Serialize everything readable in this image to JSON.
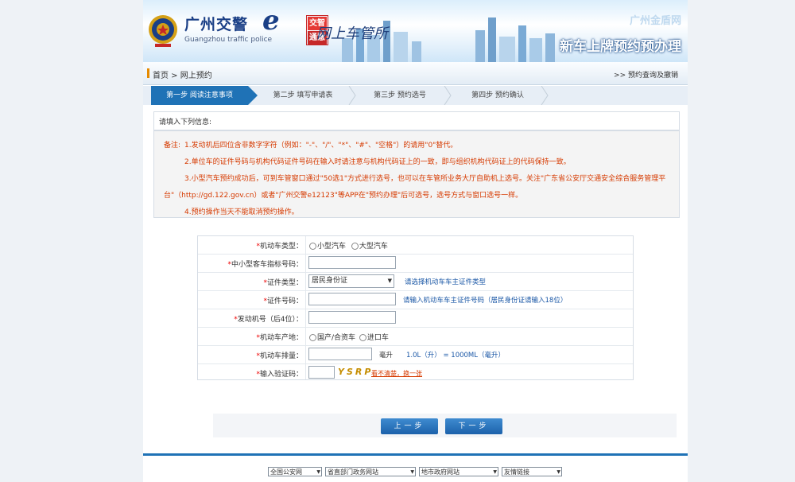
{
  "banner": {
    "logo_text": "广州交警",
    "logo_e": "e",
    "logo_sub": "Guangzhou traffic police",
    "zhi_top": "交智",
    "zhi_bottom": "通慧",
    "cursive_title": "网上车管所",
    "site_link": "广州金盾网",
    "biz_title": "新车上牌预约预办理"
  },
  "breadcrumb": {
    "text": "首页 > 网上预约",
    "right_link": ">> 预约查询及撤销"
  },
  "steps": [
    {
      "label": "第一步 阅读注意事项",
      "active": true
    },
    {
      "label": "第二步 填写申请表",
      "active": false
    },
    {
      "label": "第三步 预约选号",
      "active": false
    },
    {
      "label": "第四步 预约确认",
      "active": false
    }
  ],
  "notes": {
    "heading": "请填入下列信息:",
    "label": "备注:",
    "lines": [
      "1.发动机后四位含非数字字符（例如：\"-\"、\"/\"、\"*\"、\"#\"、\"空格\"）的请用\"0\"替代。",
      "2.单位车的证件号码与机构代码证件号码在输入时请注意与机构代码证上的一致，即与组织机构代码证上的代码保持一致。",
      "3.小型汽车预约成功后，可到车管窗口通过\"50选1\"方式进行选号，也可以在车管所业务大厅自助机上选号。关注\"广东省公安厅交通安全综合服务管理平",
      "台\"（http://gd.122.gov.cn）或者\"广州交警e12123\"等APP在\"预约办理\"后可选号，选号方式与窗口选号一样。",
      "4.预约操作当天不能取消预约操作。"
    ]
  },
  "form": {
    "vehicle_type_label": "机动车类型：",
    "vehicle_type_options": [
      "小型汽车",
      "大型汽车"
    ],
    "approval_label": "中小型客车指标号码：",
    "id_type_label": "证件类型：",
    "id_type_value": "居民身份证",
    "id_type_hint": "请选择机动车车主证件类型",
    "id_no_label": "证件号码：",
    "id_no_hint": "请输入机动车车主证件号码（居民身份证请输入18位）",
    "engine_label": "发动机号（后4位）：",
    "origin_label": "机动车产地：",
    "origin_options": [
      "国产/合资车",
      "进口车"
    ],
    "displacement_label": "机动车排量：",
    "displacement_unit": "毫升",
    "displacement_hint": "1.0L（升） = 1000ML（毫升）",
    "captcha_label": "输入验证码：",
    "captcha_text": "YSRP",
    "captcha_refresh": "看不清楚，换一张"
  },
  "buttons": {
    "back": "上一步",
    "next": "下一步"
  },
  "footer": {
    "selects": [
      "全国公安网",
      "省直部门政务网站",
      "地市政府网站",
      "友情链接"
    ]
  },
  "colors": {
    "primary": "#1f72b6",
    "notice": "#d63a00",
    "required": "#e00000",
    "hint": "#1a57a6"
  }
}
